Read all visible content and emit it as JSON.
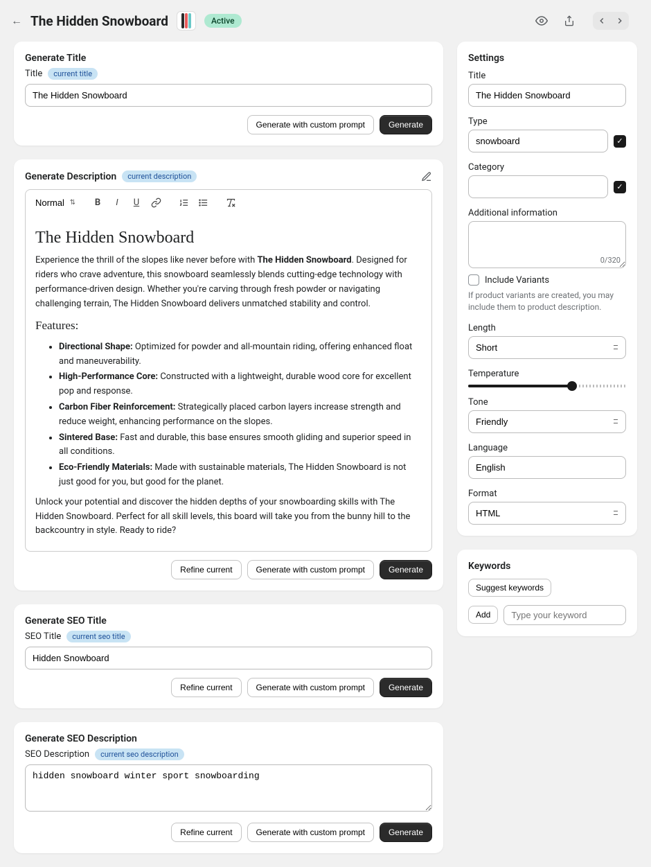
{
  "header": {
    "title": "The Hidden Snowboard",
    "status": "Active"
  },
  "sections": {
    "generate_title": {
      "heading": "Generate Title",
      "field_label": "Title",
      "tag": "current title",
      "value": "The Hidden Snowboard",
      "btn_custom": "Generate with custom prompt",
      "btn_generate": "Generate"
    },
    "generate_description": {
      "heading": "Generate Description",
      "tag": "current description",
      "toolbar_format": "Normal",
      "content": {
        "h1": "The Hidden Snowboard",
        "intro_a": "Experience the thrill of the slopes like never before with ",
        "intro_strong": "The Hidden Snowboard",
        "intro_b": ". Designed for riders who crave adventure, this snowboard seamlessly blends cutting-edge technology with performance-driven design. Whether you're carving through fresh powder or navigating challenging terrain, The Hidden Snowboard delivers unmatched stability and control.",
        "features_h": "Features:",
        "features": [
          {
            "k": "Directional Shape:",
            "v": " Optimized for powder and all-mountain riding, offering enhanced float and maneuverability."
          },
          {
            "k": "High-Performance Core:",
            "v": " Constructed with a lightweight, durable wood core for excellent pop and response."
          },
          {
            "k": "Carbon Fiber Reinforcement:",
            "v": " Strategically placed carbon layers increase strength and reduce weight, enhancing performance on the slopes."
          },
          {
            "k": "Sintered Base:",
            "v": " Fast and durable, this base ensures smooth gliding and superior speed in all conditions."
          },
          {
            "k": "Eco-Friendly Materials:",
            "v": " Made with sustainable materials, The Hidden Snowboard is not just good for you, but good for the planet."
          }
        ],
        "outro": "Unlock your potential and discover the hidden depths of your snowboarding skills with The Hidden Snowboard. Perfect for all skill levels, this board will take you from the bunny hill to the backcountry in style. Ready to ride?"
      },
      "btn_refine": "Refine current",
      "btn_custom": "Generate with custom prompt",
      "btn_generate": "Generate"
    },
    "generate_seo_title": {
      "heading": "Generate SEO Title",
      "field_label": "SEO Title",
      "tag": "current seo title",
      "value": "Hidden Snowboard",
      "btn_refine": "Refine current",
      "btn_custom": "Generate with custom prompt",
      "btn_generate": "Generate"
    },
    "generate_seo_description": {
      "heading": "Generate SEO Description",
      "field_label": "SEO Description",
      "tag": "current seo description",
      "value": "hidden snowboard winter sport snowboarding",
      "btn_refine": "Refine current",
      "btn_custom": "Generate with custom prompt",
      "btn_generate": "Generate"
    }
  },
  "settings": {
    "heading": "Settings",
    "title_label": "Title",
    "title_value": "The Hidden Snowboard",
    "type_label": "Type",
    "type_value": "snowboard",
    "category_label": "Category",
    "category_value": "",
    "additional_label": "Additional information",
    "additional_count": "0/320",
    "include_variants_label": "Include Variants",
    "include_variants_help": "If product variants are created, you may include them to product description.",
    "length_label": "Length",
    "length_value": "Short",
    "temperature_label": "Temperature",
    "temperature_percent": 66,
    "tone_label": "Tone",
    "tone_value": "Friendly",
    "language_label": "Language",
    "language_value": "English",
    "format_label": "Format",
    "format_value": "HTML"
  },
  "keywords": {
    "heading": "Keywords",
    "suggest_btn": "Suggest keywords",
    "add_btn": "Add",
    "placeholder": "Type your keyword"
  }
}
